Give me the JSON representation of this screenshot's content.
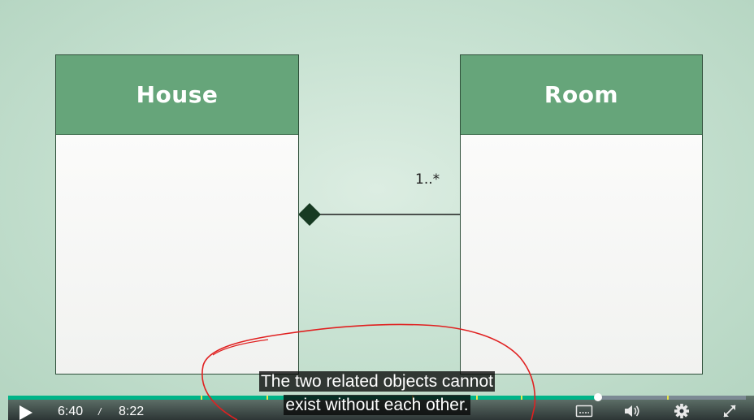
{
  "diagram": {
    "left_class": "House",
    "right_class": "Room",
    "multiplicity": "1..*"
  },
  "caption": {
    "line1": "The two related objects cannot",
    "line2": "exist without each other."
  },
  "player": {
    "time_current": "6:40",
    "time_separator": "/",
    "time_total": "8:22",
    "progress": 0.8,
    "accent_color": "#00b488",
    "icons": [
      "play-icon",
      "captions-icon",
      "volume-icon",
      "gear-icon",
      "fullscreen-icon"
    ]
  },
  "annotation": {
    "color": "#e02020"
  }
}
